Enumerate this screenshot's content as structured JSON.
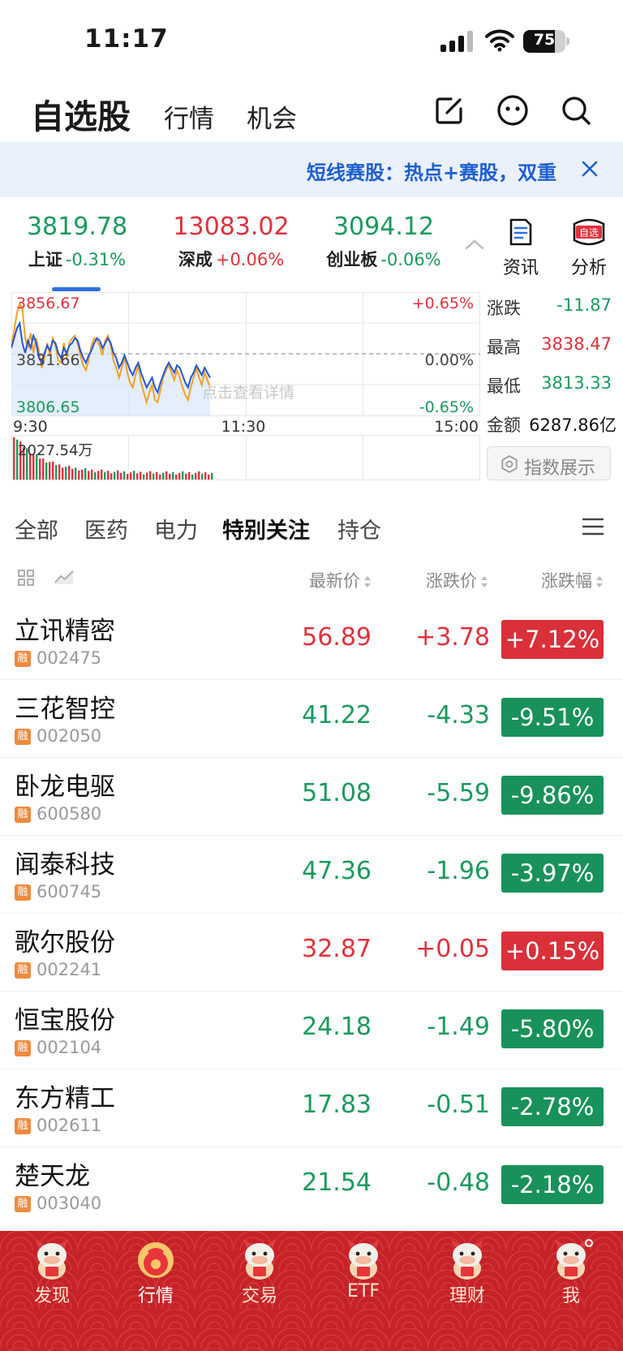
{
  "status": {
    "time": "11:17",
    "battery": "75",
    "battery_level": 0.75
  },
  "nav": {
    "title": "自选股",
    "tabs": [
      "行情",
      "机会"
    ]
  },
  "banner": {
    "text": "短线赛股：热点+赛股，双重"
  },
  "indices": [
    {
      "value": "3819.78",
      "name": "上证",
      "change": "-0.31%",
      "dir": "down"
    },
    {
      "value": "13083.02",
      "name": "深成",
      "change": "+0.06%",
      "dir": "up"
    },
    {
      "value": "3094.12",
      "name": "创业板",
      "change": "-0.06%",
      "dir": "down"
    }
  ],
  "side_buttons": {
    "news": "资讯",
    "analysis": "分析",
    "analysis_badge": "自选"
  },
  "chart": {
    "top_price": "3856.67",
    "mid_price": "3831.66",
    "bottom_price": "3806.65",
    "top_pct": "+0.65%",
    "mid_pct": "0.00%",
    "bottom_pct": "-0.65%",
    "hint": "点击查看详情",
    "t_start": "9:30",
    "t_mid": "11:30",
    "t_end": "15:00",
    "volume": "2027.54万",
    "series": {
      "index": [
        3834,
        3838,
        3842,
        3844,
        3836,
        3832,
        3837,
        3834,
        3839,
        3836,
        3830,
        3828,
        3832,
        3835,
        3833,
        3837,
        3836,
        3832,
        3830,
        3834,
        3832,
        3835,
        3836,
        3838,
        3837,
        3833,
        3830,
        3828,
        3831,
        3833,
        3836,
        3838,
        3837,
        3834,
        3836,
        3838,
        3836,
        3832,
        3830,
        3826,
        3828,
        3831,
        3828,
        3825,
        3823,
        3826,
        3828,
        3824,
        3821,
        3818,
        3820,
        3822,
        3818,
        3816,
        3820,
        3823,
        3826,
        3828,
        3826,
        3824,
        3827,
        3826,
        3823,
        3820,
        3818,
        3822,
        3824,
        3827,
        3825,
        3823,
        3826,
        3824,
        3822
      ],
      "weighted": [
        3835,
        3841,
        3848,
        3852,
        3850,
        3838,
        3834,
        3840,
        3832,
        3838,
        3833,
        3826,
        3830,
        3836,
        3831,
        3838,
        3835,
        3829,
        3828,
        3836,
        3830,
        3836,
        3838,
        3839,
        3836,
        3831,
        3827,
        3825,
        3829,
        3835,
        3838,
        3837,
        3835,
        3831,
        3837,
        3839,
        3835,
        3829,
        3826,
        3822,
        3826,
        3830,
        3824,
        3820,
        3818,
        3823,
        3827,
        3820,
        3816,
        3812,
        3816,
        3819,
        3813,
        3812,
        3817,
        3822,
        3825,
        3827,
        3824,
        3821,
        3825,
        3822,
        3818,
        3815,
        3813,
        3818,
        3822,
        3826,
        3822,
        3819,
        3824,
        3821,
        3818
      ]
    }
  },
  "stats": [
    {
      "label": "涨跌",
      "value": "-11.87",
      "dir": "down"
    },
    {
      "label": "最高",
      "value": "3838.47",
      "dir": "up"
    },
    {
      "label": "最低",
      "value": "3813.33",
      "dir": "down"
    },
    {
      "label": "金额",
      "value": "6287.86亿",
      "dir": "flat"
    }
  ],
  "index_display_btn": "指数展示",
  "categories": [
    "全部",
    "医药",
    "电力",
    "特别关注",
    "持仓"
  ],
  "active_category": 3,
  "columns": {
    "price": "最新价",
    "change": "涨跌价",
    "pct": "涨跌幅"
  },
  "stocks": [
    {
      "name": "立讯精密",
      "code": "002475",
      "price": "56.89",
      "change": "+3.78",
      "pct": "+7.12%",
      "dir": "up"
    },
    {
      "name": "三花智控",
      "code": "002050",
      "price": "41.22",
      "change": "-4.33",
      "pct": "-9.51%",
      "dir": "down"
    },
    {
      "name": "卧龙电驱",
      "code": "600580",
      "price": "51.08",
      "change": "-5.59",
      "pct": "-9.86%",
      "dir": "down"
    },
    {
      "name": "闻泰科技",
      "code": "600745",
      "price": "47.36",
      "change": "-1.96",
      "pct": "-3.97%",
      "dir": "down"
    },
    {
      "name": "歌尔股份",
      "code": "002241",
      "price": "32.87",
      "change": "+0.05",
      "pct": "+0.15%",
      "dir": "up"
    },
    {
      "name": "恒宝股份",
      "code": "002104",
      "price": "24.18",
      "change": "-1.49",
      "pct": "-5.80%",
      "dir": "down"
    },
    {
      "name": "东方精工",
      "code": "002611",
      "price": "17.83",
      "change": "-0.51",
      "pct": "-2.78%",
      "dir": "down"
    },
    {
      "name": "楚天龙",
      "code": "003040",
      "price": "21.54",
      "change": "-0.48",
      "pct": "-2.18%",
      "dir": "down"
    }
  ],
  "rong_label": "融",
  "tabbar": [
    "发现",
    "行情",
    "交易",
    "ETF",
    "理财",
    "我"
  ],
  "active_tab": 1,
  "colors": {
    "up": "#e0313c",
    "down": "#1a9a5c",
    "accent": "#2c6fe0",
    "tabbar": "#c42328"
  }
}
